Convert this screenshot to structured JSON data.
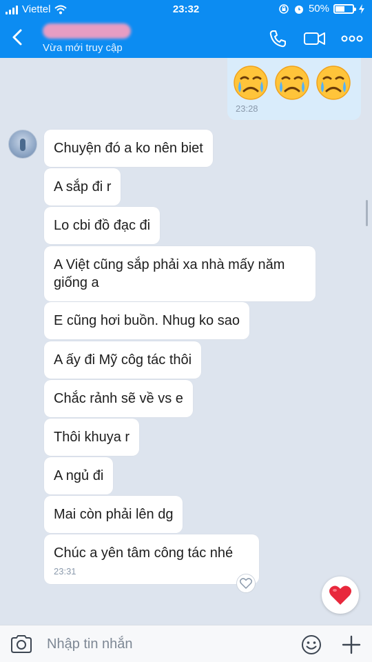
{
  "status_bar": {
    "carrier": "Viettel",
    "time": "23:32",
    "battery": "50%",
    "battery_level": 0.5
  },
  "header": {
    "presence": "Vừa mới truy cập",
    "icons": [
      "back-arrow-icon",
      "phone-icon",
      "video-call-icon",
      "more-icon"
    ]
  },
  "sent_message": {
    "emojis": [
      "crying-face-emoji",
      "crying-face-emoji",
      "crying-face-emoji"
    ],
    "time": "23:28"
  },
  "received_messages": [
    {
      "text": "Chuyện đó a ko nên biet"
    },
    {
      "text": "A sắp đi r"
    },
    {
      "text": "Lo cbi đồ đạc đi"
    },
    {
      "text": "A Việt cũng sắp phải xa nhà mấy năm giống a"
    },
    {
      "text": "E cũng hơi buồn. Nhug ko sao"
    },
    {
      "text": "A ấy đi Mỹ côg tác thôi"
    },
    {
      "text": "Chắc rảnh sẽ về vs e"
    },
    {
      "text": "Thôi khuya r"
    },
    {
      "text": "A ngủ đi"
    },
    {
      "text": "Mai còn phải lên dg"
    },
    {
      "text": "Chúc a yên tâm công tác nhé",
      "time": "23:31"
    }
  ],
  "input_bar": {
    "placeholder": "Nhập tin nhắn"
  },
  "colors": {
    "header_blue": "#0c8cf2",
    "chat_background": "#dde4ee",
    "sent_bubble": "#d9ecfb",
    "heart_red": "#e8283c"
  }
}
